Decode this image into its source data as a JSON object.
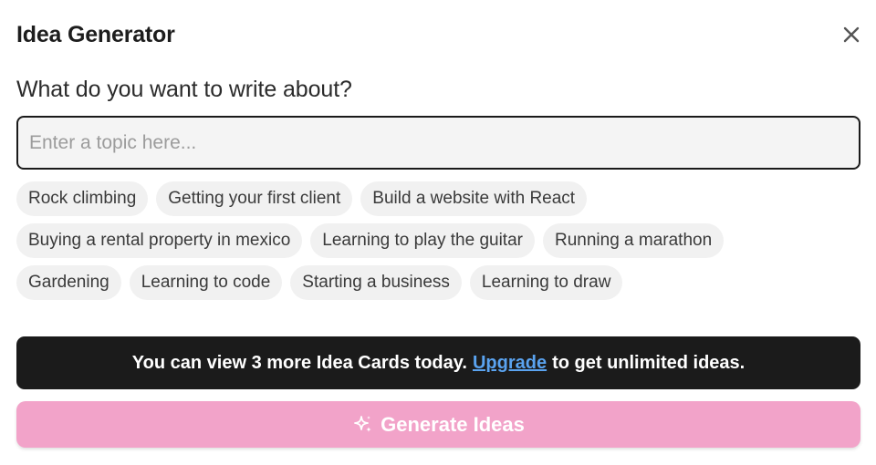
{
  "header": {
    "title": "Idea Generator",
    "close_icon": "close-icon"
  },
  "question": "What do you want to write about?",
  "topic_input": {
    "value": "",
    "placeholder": "Enter a topic here..."
  },
  "suggestions": {
    "rows": [
      [
        "Rock climbing",
        "Getting your first client",
        "Build a website with React"
      ],
      [
        "Buying a rental property in mexico",
        "Learning to play the guitar",
        "Running a marathon"
      ],
      [
        "Gardening",
        "Learning to code",
        "Starting a business",
        "Learning to draw"
      ]
    ]
  },
  "banner": {
    "text_before": "You can view 3 more Idea Cards today.",
    "link": "Upgrade",
    "text_after": "to get unlimited ideas.",
    "link_color": "#5aa3f0"
  },
  "generate": {
    "label": "Generate Ideas",
    "icon": "sparkle-icon",
    "color": "#f2a3c9"
  }
}
